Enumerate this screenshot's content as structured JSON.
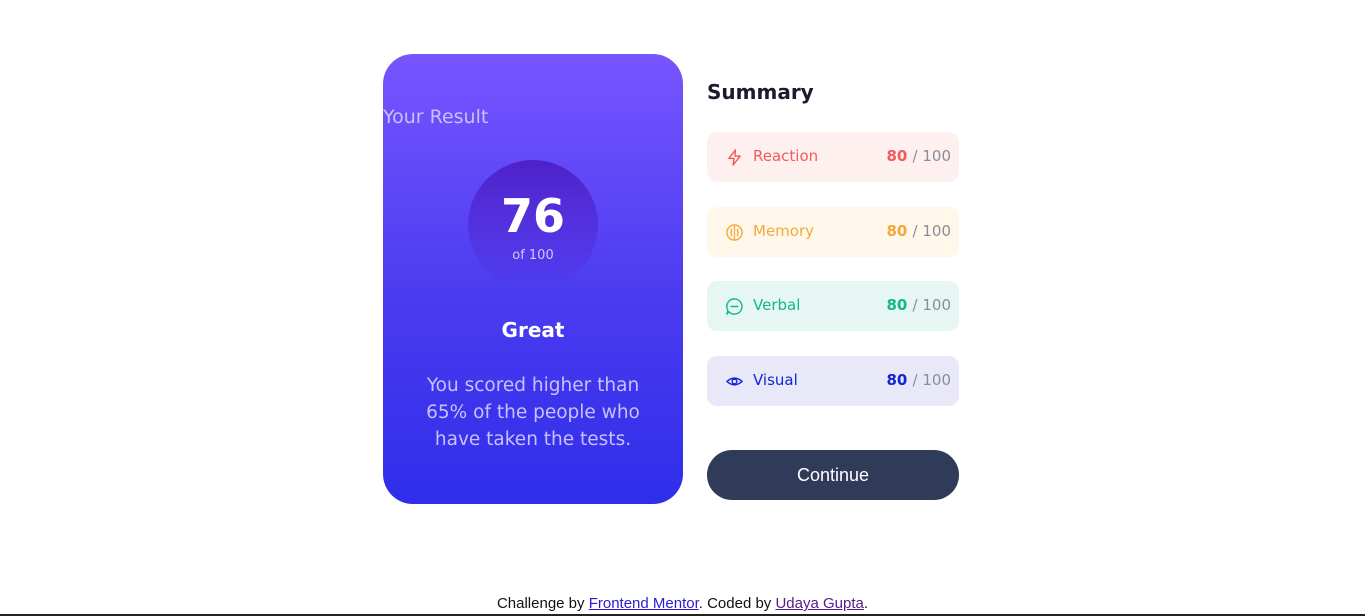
{
  "result": {
    "title": "Your Result",
    "score": "76",
    "score_of": "of 100",
    "rating": "Great",
    "description": "You scored higher than 65% of the people who have taken the tests."
  },
  "summary": {
    "title": "Summary",
    "items": [
      {
        "label": "Reaction",
        "score": "80",
        "out_of": "/ 100",
        "icon": "lightning-icon",
        "color": "#f25b5b",
        "bg": "#fff0f0"
      },
      {
        "label": "Memory",
        "score": "80",
        "out_of": "/ 100",
        "icon": "brain-icon",
        "color": "#f2a93b",
        "bg": "#fff8ea"
      },
      {
        "label": "Verbal",
        "score": "80",
        "out_of": "/ 100",
        "icon": "chat-bubble-icon",
        "color": "#14b886",
        "bg": "#e6f7f3"
      },
      {
        "label": "Visual",
        "score": "80",
        "out_of": "/ 100",
        "icon": "eye-icon",
        "color": "#1125d4",
        "bg": "#e9e8f8"
      }
    ]
  },
  "continue_label": "Continue",
  "footer": {
    "prefix": "Challenge by",
    "link1": "Frontend Mentor",
    "middle": ". Coded by",
    "link2": "Udaya Gupta",
    "suffix": "."
  }
}
